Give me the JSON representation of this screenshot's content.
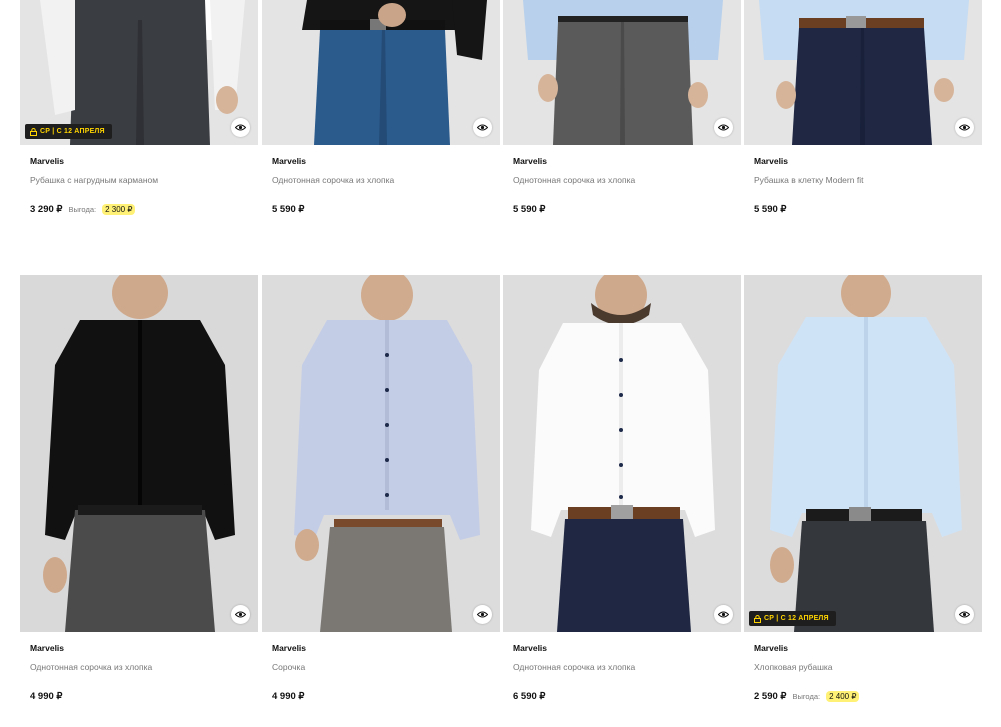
{
  "top_row": [
    {
      "brand": "Marvelis",
      "title": "Рубашка с нагрудным карманом",
      "price": "3 290 ₽",
      "benefit_label": "Выгода:",
      "benefit": "2 300 ₽",
      "badge": "СР | С 12 АПРЕЛЯ"
    },
    {
      "brand": "Marvelis",
      "title": "Однотонная сорочка из хлопка",
      "price": "5 590 ₽"
    },
    {
      "brand": "Marvelis",
      "title": "Однотонная сорочка из хлопка",
      "price": "5 590 ₽"
    },
    {
      "brand": "Marvelis",
      "title": "Рубашка в клетку Modern fit",
      "price": "5 590 ₽"
    }
  ],
  "bottom_row": [
    {
      "brand": "Marvelis",
      "title": "Однотонная сорочка из хлопка",
      "price": "4 990 ₽"
    },
    {
      "brand": "Marvelis",
      "title": "Сорочка",
      "price": "4 990 ₽"
    },
    {
      "brand": "Marvelis",
      "title": "Однотонная сорочка из хлопка",
      "price": "6 590 ₽"
    },
    {
      "brand": "Marvelis",
      "title": "Хлопковая рубашка",
      "price": "2 590 ₽",
      "benefit_label": "Выгода:",
      "benefit": "2 400 ₽",
      "badge": "СР | С 12 АПРЕЛЯ"
    }
  ],
  "colors": {
    "badge_bg": "#1e1e1e",
    "badge_text": "#ffd400",
    "benefit_highlight": "#fff176"
  },
  "icons": {
    "quick_view": "eye-icon",
    "badge": "lock-icon"
  }
}
